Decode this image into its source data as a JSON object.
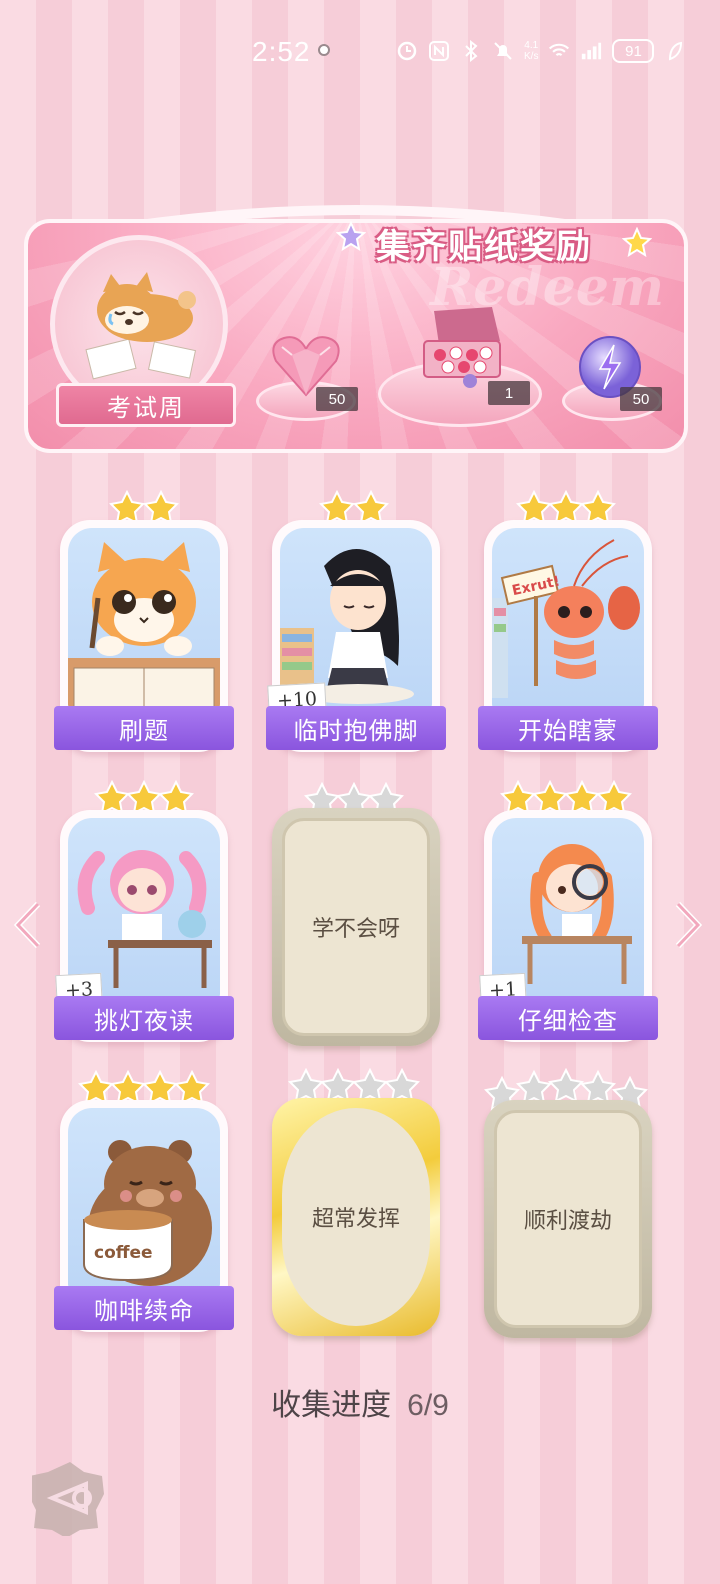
{
  "status_bar": {
    "time": "2:52",
    "net_speed_value": "4.1",
    "net_speed_unit": "K/s",
    "battery": "91",
    "icons": [
      "alarm-icon",
      "nfc-icon",
      "bluetooth-icon",
      "mute-icon",
      "wifi-icon",
      "signal-icon",
      "leaf-icon"
    ]
  },
  "banner": {
    "title": "集齐贴纸奖励",
    "watermark": "Redeem",
    "theme_label": "考试周",
    "rewards": [
      {
        "name": "heart-gem",
        "count": "50"
      },
      {
        "name": "sticker-box",
        "count": "1"
      },
      {
        "name": "lightning-orb",
        "count": "50"
      }
    ]
  },
  "stickers": [
    {
      "label": "刷题",
      "stars": 2,
      "collected": true,
      "badge": "",
      "art": "cat-writing"
    },
    {
      "label": "临时抱佛脚",
      "stars": 2,
      "collected": true,
      "badge": "+10",
      "art": "girl-praying"
    },
    {
      "label": "开始瞎蒙",
      "stars": 3,
      "collected": true,
      "badge": "",
      "art": "shrimp-sign"
    },
    {
      "label": "挑灯夜读",
      "stars": 3,
      "collected": true,
      "badge": "+3",
      "art": "girl-studying"
    },
    {
      "label": "学不会呀",
      "stars": 3,
      "collected": false,
      "badge": "",
      "art": ""
    },
    {
      "label": "仔细检查",
      "stars": 4,
      "collected": true,
      "badge": "+1",
      "art": "girl-magnifier"
    },
    {
      "label": "咖啡续命",
      "stars": 4,
      "collected": true,
      "badge": "",
      "art": "bear-coffee"
    },
    {
      "label": "超常发挥",
      "stars": 4,
      "collected": false,
      "badge": "",
      "art": "",
      "gold": true
    },
    {
      "label": "顺利渡劫",
      "stars": 5,
      "collected": false,
      "badge": "",
      "art": ""
    }
  ],
  "sign_text": "Exrut!",
  "coffee_text": "coffee",
  "progress": {
    "label": "收集进度",
    "value": "6/9"
  },
  "colors": {
    "accent": "#8a55de",
    "pink": "#f28eab",
    "star": "#f7c93b"
  }
}
